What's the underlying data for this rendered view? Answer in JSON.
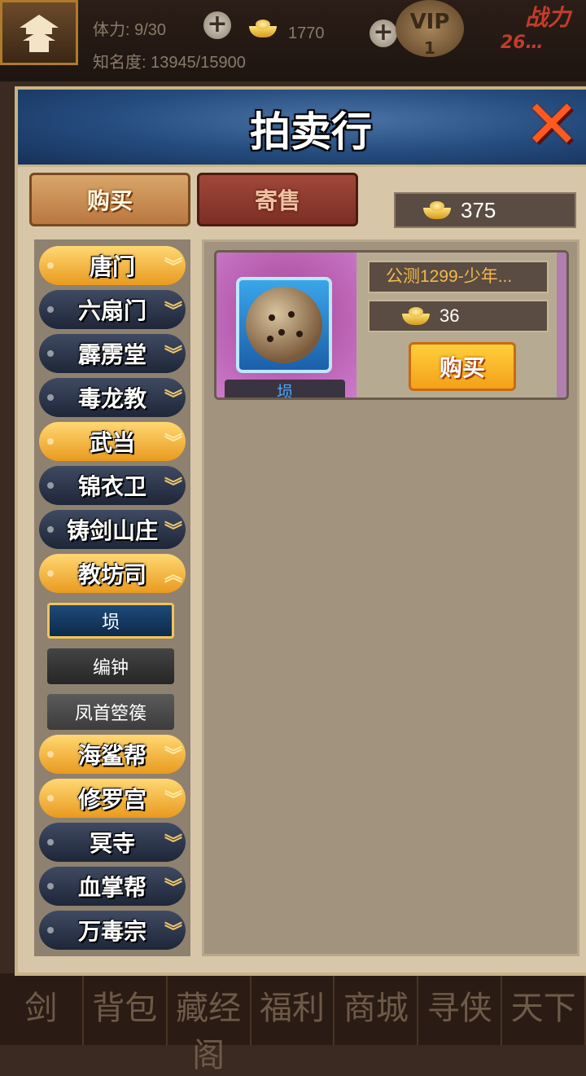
{
  "hud": {
    "stamina": "体力: 9/30",
    "gold_top": "1770",
    "fame": "知名度: 13945/15900",
    "vip": "VIP",
    "vip_level": "1",
    "power_label": "战力",
    "power_value": "26…"
  },
  "bottom_nav": [
    "剑",
    "背包",
    "藏经阁",
    "福利",
    "商城",
    "寻侠",
    "天下"
  ],
  "dialog": {
    "title": "拍卖行",
    "tabs": {
      "buy": "购买",
      "sell": "寄售"
    },
    "gold_balance": "375"
  },
  "categories": [
    {
      "label": "唐门",
      "style": "gold",
      "expanded": false
    },
    {
      "label": "六扇门",
      "style": "dark",
      "expanded": false
    },
    {
      "label": "霹雳堂",
      "style": "dark",
      "expanded": false
    },
    {
      "label": "毒龙教",
      "style": "dark",
      "expanded": false
    },
    {
      "label": "武当",
      "style": "gold",
      "expanded": false
    },
    {
      "label": "锦衣卫",
      "style": "dark",
      "expanded": false
    },
    {
      "label": "铸剑山庄",
      "style": "dark",
      "expanded": false
    },
    {
      "label": "教坊司",
      "style": "gold",
      "expanded": true
    },
    {
      "label": "海鲨帮",
      "style": "gold",
      "expanded": false
    },
    {
      "label": "修罗宫",
      "style": "gold",
      "expanded": false
    },
    {
      "label": "冥寺",
      "style": "dark",
      "expanded": false
    },
    {
      "label": "血掌帮",
      "style": "dark",
      "expanded": false
    },
    {
      "label": "万毒宗",
      "style": "dark",
      "expanded": false
    }
  ],
  "subcategories": [
    {
      "label": "埙",
      "active": true
    },
    {
      "label": "编钟",
      "active": false
    },
    {
      "label": "凤首箜篌",
      "active": false
    }
  ],
  "listing": {
    "item_name": "埙",
    "seller": "公测1299-少年...",
    "price": "36",
    "buy_label": "购买"
  },
  "colors": {
    "header_blue": "#244a7c",
    "gold_button": "#f3a11a",
    "item_name": "#4aa8ff",
    "seller_text": "#f3b94c"
  }
}
